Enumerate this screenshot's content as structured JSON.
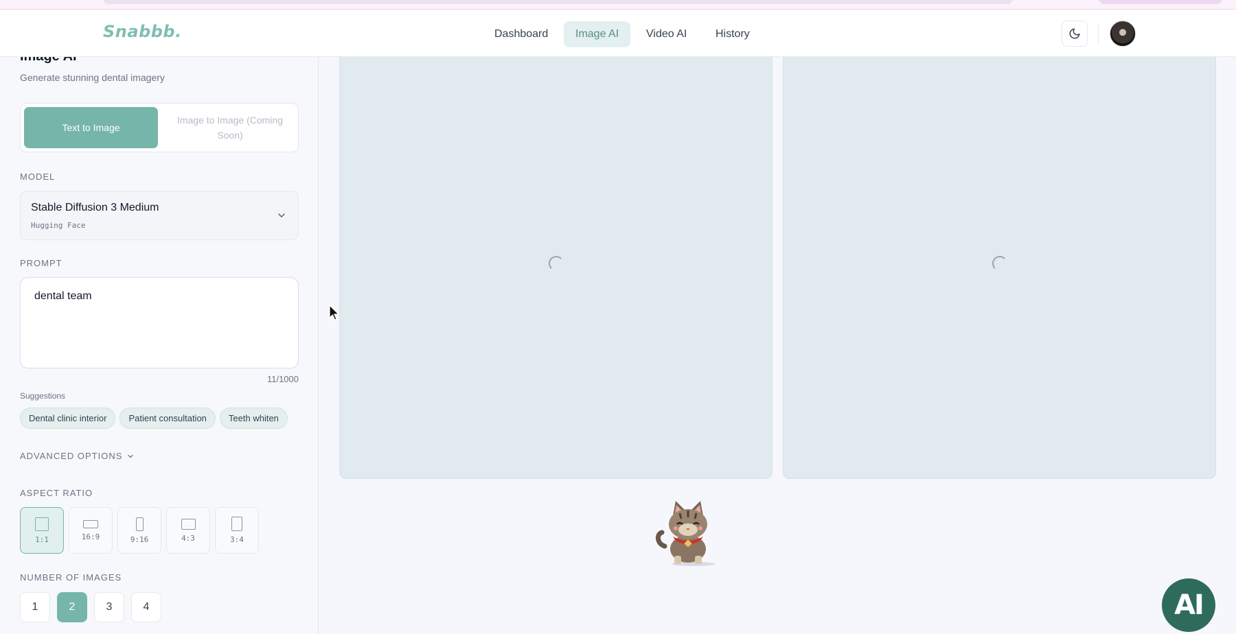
{
  "app": {
    "logo": "Snabbb."
  },
  "nav": {
    "items": [
      "Dashboard",
      "Image AI",
      "Video AI",
      "History"
    ],
    "active": "Image AI"
  },
  "header": {
    "theme_icon": "moon-icon",
    "avatar": "user-avatar"
  },
  "sidebar": {
    "title": "Image AI",
    "subtitle": "Generate stunning dental imagery",
    "tabs": [
      {
        "label": "Text to Image",
        "active": true
      },
      {
        "label": "Image to Image (Coming Soon)",
        "active": false,
        "disabled": true
      }
    ],
    "model": {
      "label": "MODEL",
      "name": "Stable Diffusion 3 Medium",
      "provider": "Hugging Face"
    },
    "prompt": {
      "label": "PROMPT",
      "value": "dental team",
      "count": "11/1000"
    },
    "suggestions": {
      "label": "Suggestions",
      "items": [
        "Dental clinic interior",
        "Patient consultation",
        "Teeth whiten"
      ]
    },
    "advanced_label": "ADVANCED OPTIONS",
    "aspect": {
      "label": "ASPECT RATIO",
      "options": [
        "1:1",
        "16:9",
        "9:16",
        "4:3",
        "3:4"
      ],
      "selected": "1:1"
    },
    "num_images": {
      "label": "NUMBER OF IMAGES",
      "options": [
        "1",
        "2",
        "3",
        "4"
      ],
      "selected": "2"
    }
  },
  "results": {
    "state": "loading",
    "count": 2
  },
  "fab": {
    "label": "AI"
  },
  "colors": {
    "accent": "#76b5aa",
    "logo": "#7fbfb2",
    "card": "#e0eaef",
    "fab": "#2f6b5a"
  }
}
